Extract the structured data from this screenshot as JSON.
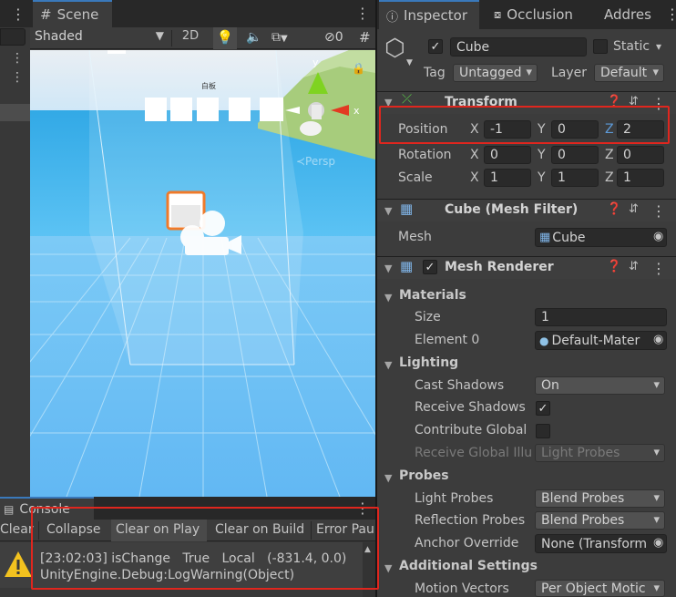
{
  "scene": {
    "tab_label": "Scene",
    "shading_mode": "Shaded",
    "btn_2d": "2D",
    "hidden_count": "0",
    "axis_y": "y",
    "axis_x": "x",
    "axis_z": "z",
    "persp_label": "≺Persp",
    "sign_text": "白板"
  },
  "inspector": {
    "tab_inspector": "Inspector",
    "tab_occlusion": "Occlusion",
    "tab_address": "Addres",
    "object_name": "Cube",
    "static_label": "Static",
    "tag_label": "Tag",
    "tag_value": "Untagged",
    "layer_label": "Layer",
    "layer_value": "Default"
  },
  "transform": {
    "title": "Transform",
    "position_label": "Position",
    "rotation_label": "Rotation",
    "scale_label": "Scale",
    "x": "X",
    "y": "Y",
    "z": "Z",
    "position": [
      "-1",
      "0",
      "2"
    ],
    "rotation": [
      "0",
      "0",
      "0"
    ],
    "scale": [
      "1",
      "1",
      "1"
    ]
  },
  "mesh_filter": {
    "title": "Cube (Mesh Filter)",
    "mesh_label": "Mesh",
    "mesh_value": "Cube"
  },
  "mesh_renderer": {
    "title": "Mesh Renderer",
    "materials_title": "Materials",
    "size_label": "Size",
    "size_value": "1",
    "element0_label": "Element 0",
    "element0_value": "Default-Mater",
    "lighting_title": "Lighting",
    "cast_shadows_label": "Cast Shadows",
    "cast_shadows_value": "On",
    "receive_shadows_label": "Receive Shadows",
    "contribute_global_label": "Contribute Global",
    "receive_global_label": "Receive Global Illu",
    "receive_global_value": "Light Probes",
    "probes_title": "Probes",
    "light_probes_label": "Light Probes",
    "light_probes_value": "Blend Probes",
    "reflection_probes_label": "Reflection Probes",
    "reflection_probes_value": "Blend Probes",
    "anchor_override_label": "Anchor Override",
    "anchor_override_value": "None (Transform",
    "additional_title": "Additional Settings",
    "motion_vectors_label": "Motion Vectors",
    "motion_vectors_value": "Per Object Motic"
  },
  "console": {
    "tab_label": "Console",
    "btn_clear": "Clear",
    "btn_collapse": "Collapse",
    "btn_clear_on_play": "Clear on Play",
    "btn_clear_on_build": "Clear on Build",
    "btn_error_pause": "Error Pau",
    "log_line1": "[23:02:03] isChange   True   Local   (-831.4, 0.0)",
    "log_line2": "UnityEngine.Debug:LogWarning(Object)"
  },
  "colors": {
    "accent": "#3a79bb",
    "highlight_box": "#e0261e",
    "sky": "#3bb6f0",
    "ground": "#74c6f7"
  }
}
